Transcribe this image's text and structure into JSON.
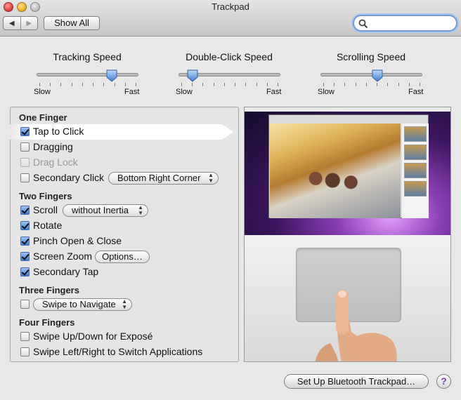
{
  "window": {
    "title": "Trackpad"
  },
  "toolbar": {
    "back_glyph": "◀",
    "forward_glyph": "▶",
    "show_all_label": "Show All",
    "search_value": ""
  },
  "sliders": [
    {
      "label": "Tracking Speed",
      "min_label": "Slow",
      "max_label": "Fast",
      "value_fraction": 0.75
    },
    {
      "label": "Double-Click Speed",
      "min_label": "Slow",
      "max_label": "Fast",
      "value_fraction": 0.12
    },
    {
      "label": "Scrolling Speed",
      "min_label": "Slow",
      "max_label": "Fast",
      "value_fraction": 0.56
    }
  ],
  "one_finger": {
    "title": "One Finger",
    "tap_to_click": {
      "label": "Tap to Click",
      "checked": true
    },
    "dragging": {
      "label": "Dragging",
      "checked": false
    },
    "drag_lock": {
      "label": "Drag Lock",
      "checked": false,
      "disabled": true
    },
    "secondary_click": {
      "label": "Secondary Click",
      "checked": false,
      "option": "Bottom Right Corner"
    }
  },
  "two_fingers": {
    "title": "Two Fingers",
    "scroll": {
      "label": "Scroll",
      "checked": true,
      "option": "without Inertia"
    },
    "rotate": {
      "label": "Rotate",
      "checked": true
    },
    "pinch": {
      "label": "Pinch Open & Close",
      "checked": true
    },
    "screen_zoom": {
      "label": "Screen Zoom",
      "checked": true,
      "button": "Options…"
    },
    "secondary_tap": {
      "label": "Secondary Tap",
      "checked": true
    }
  },
  "three_fingers": {
    "title": "Three Fingers",
    "swipe": {
      "checked": false,
      "option": "Swipe to Navigate"
    }
  },
  "four_fingers": {
    "title": "Four Fingers",
    "swipe_expose": {
      "label": "Swipe Up/Down for Exposé",
      "checked": false
    },
    "swipe_switch": {
      "label": "Swipe Left/Right to Switch Applications",
      "checked": false
    }
  },
  "footer": {
    "setup_label": "Set Up Bluetooth Trackpad…",
    "help_label": "?"
  }
}
